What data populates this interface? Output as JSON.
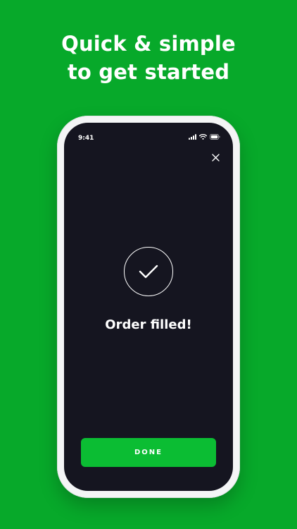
{
  "headline": {
    "line1": "Quick & simple",
    "line2": "to get started"
  },
  "status_bar": {
    "time": "9:41",
    "icons": [
      "signal-icon",
      "wifi-icon",
      "battery-icon"
    ]
  },
  "close_icon": "close-icon",
  "confirmation": {
    "icon": "checkmark-icon",
    "message": "Order filled!"
  },
  "done_button": {
    "label": "DONE"
  },
  "colors": {
    "background": "#07a92a",
    "screen": "#151520",
    "button": "#0bbd33",
    "text": "#ffffff"
  }
}
